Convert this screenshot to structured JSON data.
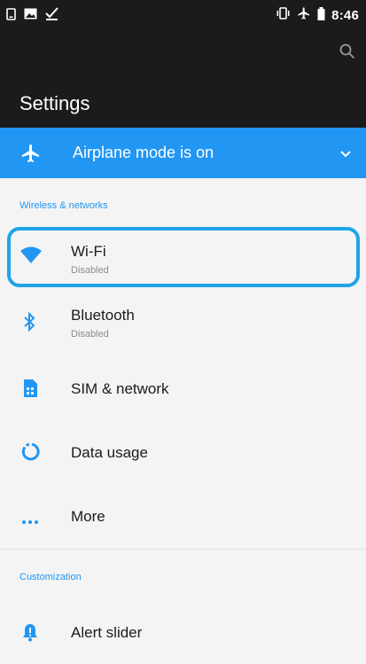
{
  "status_bar": {
    "time": "8:46",
    "left_icons": [
      "phone-icon",
      "image-icon",
      "checkmark-icon"
    ],
    "right_icons": [
      "vibrate-icon",
      "airplane-icon",
      "battery-icon"
    ]
  },
  "app_bar": {
    "title": "Settings",
    "search_icon": "search-icon"
  },
  "airplane_banner": {
    "label": "Airplane mode is on",
    "icon": "airplane-icon",
    "expand_icon": "chevron-down-icon"
  },
  "sections": [
    {
      "header": "Wireless & networks",
      "items": [
        {
          "label": "Wi-Fi",
          "summary": "Disabled",
          "icon": "wifi-icon"
        },
        {
          "label": "Bluetooth",
          "summary": "Disabled",
          "icon": "bluetooth-icon"
        },
        {
          "label": "SIM & network",
          "icon": "sim-card-icon"
        },
        {
          "label": "Data usage",
          "icon": "data-usage-icon"
        },
        {
          "label": "More",
          "icon": "more-icon"
        }
      ]
    },
    {
      "header": "Customization",
      "items": [
        {
          "label": "Alert slider",
          "icon": "bell-icon"
        }
      ]
    }
  ],
  "colors": {
    "accent": "#2196f3",
    "dark_bar": "#1b1b1b",
    "background": "#f4f4f4",
    "highlight": "#1ea4e9"
  }
}
